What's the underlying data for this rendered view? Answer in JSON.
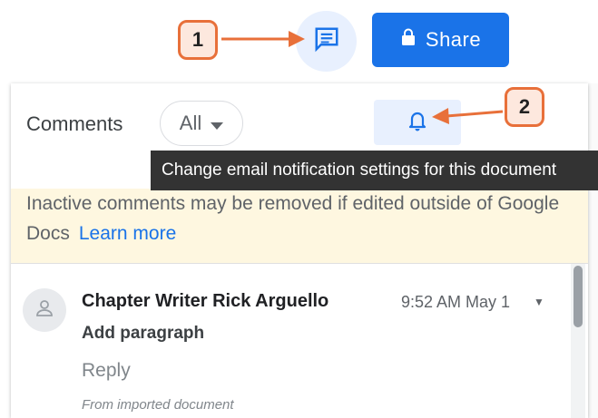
{
  "header": {
    "share_label": "Share",
    "comments_icon": "comment-icon",
    "lock_icon": "lock-icon"
  },
  "callouts": [
    {
      "label": "1"
    },
    {
      "label": "2"
    }
  ],
  "panel": {
    "title": "Comments",
    "filter": {
      "selected": "All"
    },
    "bell_icon": "bell-icon",
    "tooltip": "Change email notification settings for this document"
  },
  "banner": {
    "text": "Inactive comments may be removed if edited outside of Google Docs",
    "link": "Learn more"
  },
  "comments": [
    {
      "author": "Chapter Writer Rick Arguello",
      "time": "9:52 AM May 1",
      "text": "Add paragraph",
      "reply_label": "Reply",
      "source": "From imported document"
    }
  ],
  "colors": {
    "accent": "#1a73e8",
    "callout_border": "#e8703a",
    "banner_bg": "#fef7e0",
    "tooltip_bg": "#333333"
  }
}
